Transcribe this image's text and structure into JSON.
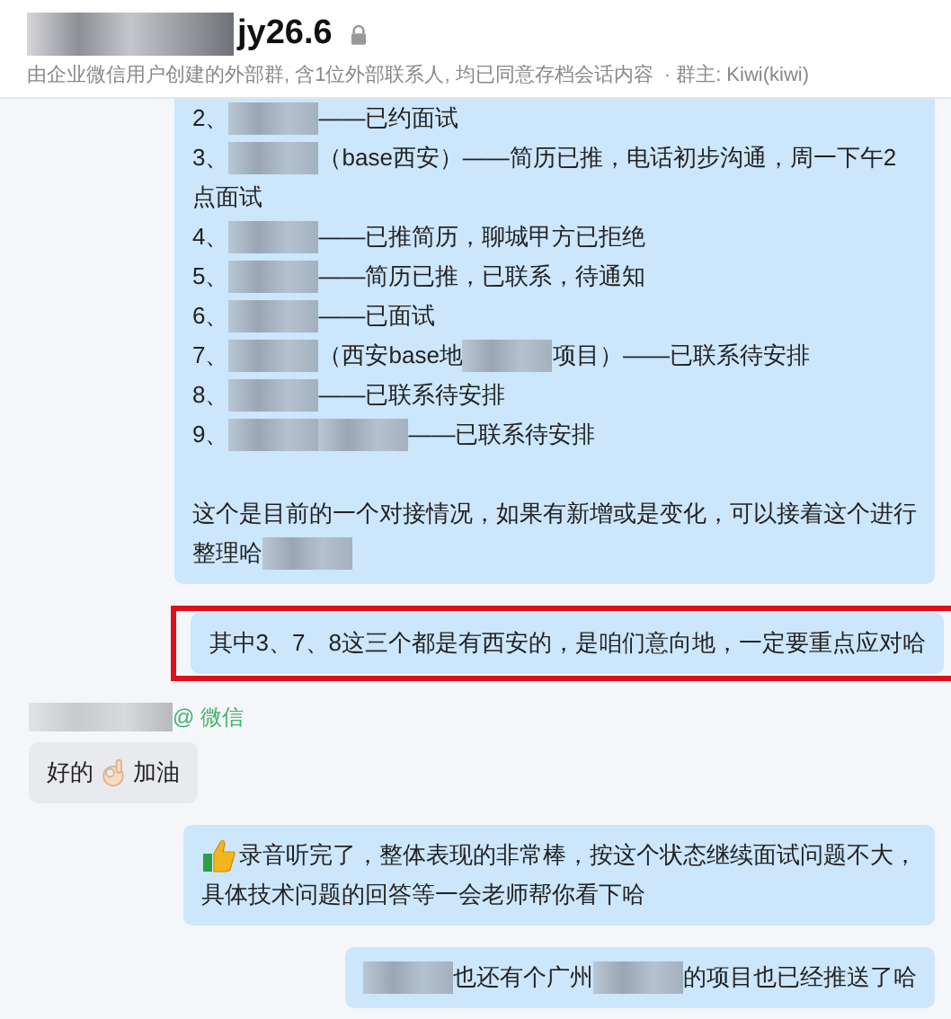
{
  "header": {
    "title": "jy26.6",
    "subtitle": "由企业微信用户创建的外部群, 含1位外部联系人, 均已同意存档会话内容",
    "owner": "· 群主: Kiwi(kiwi)"
  },
  "messages": [
    {
      "kind": "outgoing",
      "highlighted": false,
      "paragraphs": [
        [
          [
            {
              "kind": "text",
              "text": "2、"
            },
            {
              "kind": "blur"
            },
            {
              "kind": "text",
              "text": "——已约面试"
            }
          ],
          [
            {
              "kind": "text",
              "text": "3、"
            },
            {
              "kind": "blur"
            },
            {
              "kind": "text",
              "text": "（base西安）——简历已推，电话初步沟通，周一下午2"
            }
          ],
          [
            {
              "kind": "text",
              "text": "点面试"
            }
          ],
          [
            {
              "kind": "text",
              "text": "4、"
            },
            {
              "kind": "blur"
            },
            {
              "kind": "text",
              "text": "——已推简历，聊城甲方已拒绝"
            }
          ],
          [
            {
              "kind": "text",
              "text": "5、"
            },
            {
              "kind": "blur"
            },
            {
              "kind": "text",
              "text": "——简历已推，已联系，待通知"
            }
          ],
          [
            {
              "kind": "text",
              "text": "6、"
            },
            {
              "kind": "blur"
            },
            {
              "kind": "text",
              "text": "——已面试"
            }
          ],
          [
            {
              "kind": "text",
              "text": "7、"
            },
            {
              "kind": "blur"
            },
            {
              "kind": "text",
              "text": "（西安base地"
            },
            {
              "kind": "blur"
            },
            {
              "kind": "text",
              "text": "项目）——已联系待安排"
            }
          ],
          [
            {
              "kind": "text",
              "text": "8、"
            },
            {
              "kind": "blur"
            },
            {
              "kind": "text",
              "text": "——已联系待安排"
            }
          ],
          [
            {
              "kind": "text",
              "text": "9、"
            },
            {
              "kind": "blur"
            },
            {
              "kind": "blur"
            },
            {
              "kind": "text",
              "text": "——已联系待安排"
            }
          ]
        ],
        [
          [
            {
              "kind": "text",
              "text": "这个是目前的一个对接情况，如果有新增或是变化，可以接着这个进行"
            }
          ],
          [
            {
              "kind": "text",
              "text": "整理哈"
            },
            {
              "kind": "blur"
            }
          ]
        ]
      ]
    },
    {
      "kind": "outgoing",
      "highlighted": true,
      "paragraphs": [
        [
          [
            {
              "kind": "text",
              "text": "其中3、7、8这三个都是有西安的，是咱们意向地，一定要重点应对哈"
            }
          ]
        ]
      ]
    },
    {
      "kind": "incoming",
      "highlighted": false,
      "sender": {
        "via": "@ 微信"
      },
      "paragraphs": [
        [
          [
            {
              "kind": "text",
              "text": "好的"
            },
            {
              "kind": "okhand"
            },
            {
              "kind": "text",
              "text": "加油"
            }
          ]
        ]
      ]
    },
    {
      "kind": "outgoing",
      "highlighted": false,
      "paragraphs": [
        [
          [
            {
              "kind": "thumbsup"
            },
            {
              "kind": "text",
              "text": "录音听完了，整体表现的非常棒，按这个状态继续面试问题不大，"
            }
          ],
          [
            {
              "kind": "text",
              "text": "具体技术问题的回答等一会老师帮你看下哈"
            }
          ]
        ]
      ]
    },
    {
      "kind": "outgoing",
      "highlighted": false,
      "paragraphs": [
        [
          [
            {
              "kind": "blur"
            },
            {
              "kind": "text",
              "text": "也还有个广州"
            },
            {
              "kind": "blur"
            },
            {
              "kind": "text",
              "text": "的项目也已经推送了哈"
            }
          ]
        ]
      ]
    }
  ]
}
